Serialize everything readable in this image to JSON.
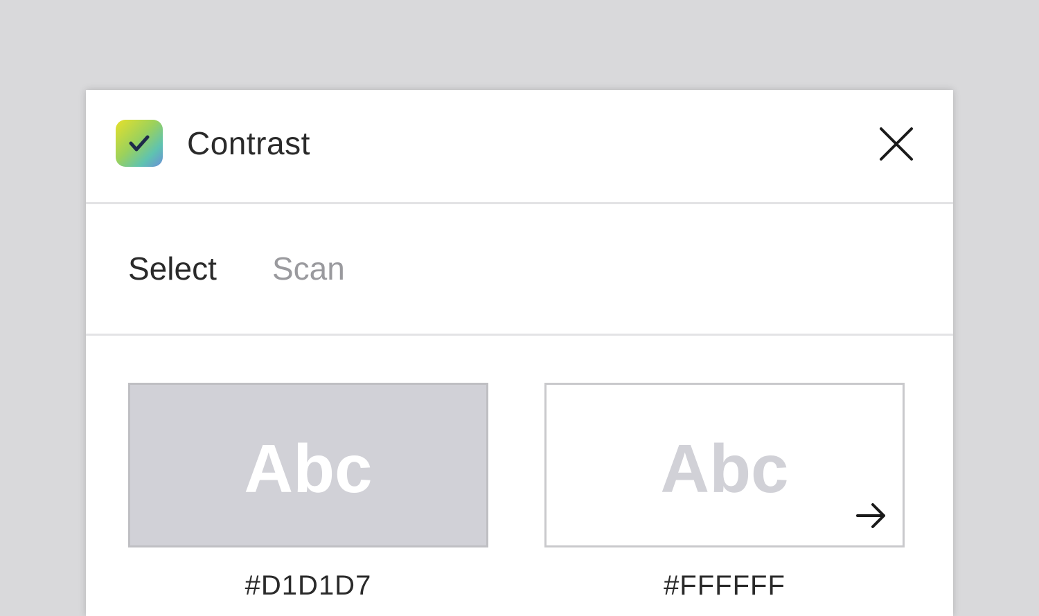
{
  "window": {
    "title": "Contrast",
    "app_icon": "checkmark-app-icon",
    "close_icon": "close-icon"
  },
  "tabs": [
    {
      "label": "Select",
      "active": true
    },
    {
      "label": "Scan",
      "active": false
    }
  ],
  "swatches": [
    {
      "sample_text": "Abc",
      "background": "#D1D1D7",
      "text_color": "#FFFFFF",
      "hex_label": "#D1D1D7"
    },
    {
      "sample_text": "Abc",
      "background": "#FFFFFF",
      "text_color": "#D1D1D7",
      "hex_label": "#FFFFFF"
    }
  ],
  "swap_icon": "arrow-right-icon",
  "colors": {
    "backdrop": "#D9D9DB",
    "panel": "#FFFFFF",
    "divider": "#E3E3E5",
    "text_primary": "#2A2A2A",
    "text_muted": "#9A9A9E"
  }
}
